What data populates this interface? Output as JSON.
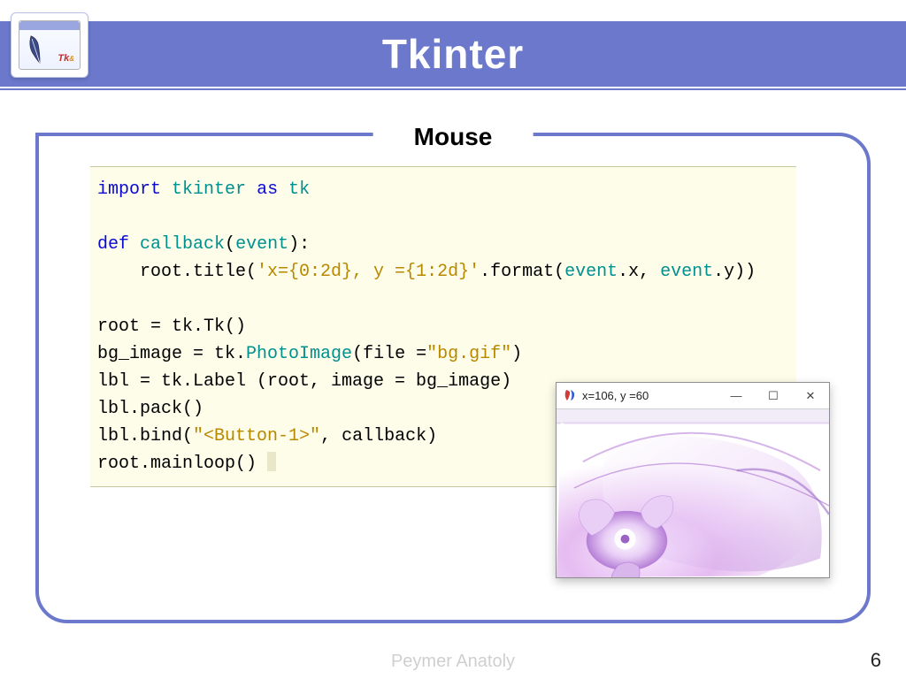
{
  "header": {
    "title": "Tkinter",
    "logo_text_1": "Tk",
    "logo_text_2": "&"
  },
  "subheading": "Mouse",
  "code": {
    "l1_import": "import",
    "l1_mod": "tkinter",
    "l1_as": "as",
    "l1_alias": "tk",
    "l3_def": "def",
    "l3_name": "callback",
    "l3_arg": "event",
    "l4_indent": "    root.title(",
    "l4_str": "'x={0:2d}, y ={1:2d}'",
    "l4_fmt": ".format(",
    "l4_ev1": "event",
    "l4_dotx": ".x,",
    "l4_ev2": "event",
    "l4_doty": ".y))",
    "l6": "root = tk.Tk()",
    "l7a": "bg_image = tk.",
    "l7b": "PhotoImage",
    "l7c": "(file =",
    "l7str": "\"bg.gif\"",
    "l7d": ")",
    "l8": "lbl = tk.Label (root, image = bg_image)",
    "l9": "lbl.pack()",
    "l10a": "lbl.bind(",
    "l10str": "\"<Button-1>\"",
    "l10b": ", callback)",
    "l11": "root.mainloop() "
  },
  "result_window": {
    "caption": "x=106, y =60",
    "minimize": "—",
    "maximize": "☐",
    "close": "✕"
  },
  "footer": {
    "author": "Peymer Anatoly",
    "page": "6"
  }
}
